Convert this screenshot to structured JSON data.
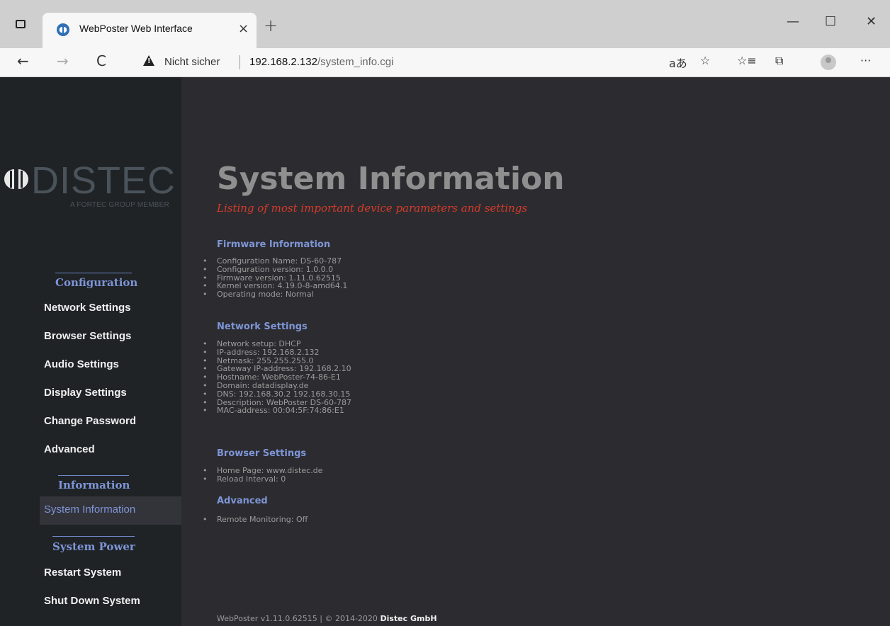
{
  "browser": {
    "tab_title": "WebPoster Web Interface",
    "tab_close": "×",
    "new_tab": "+",
    "minimize": "—",
    "maximize": "☐",
    "close": "✕",
    "back": "←",
    "forward": "→",
    "reload": "C",
    "security_label": "Nicht sicher",
    "url_host": "192.168.2.132",
    "url_path": "/system_info.cgi",
    "read_aloud": "aあ",
    "add_favorite": "☆",
    "favorites": "☆≡",
    "collections": "⧉",
    "more": "···"
  },
  "logo": {
    "text": "DISTEC",
    "subtitle": "A FORTEC GROUP MEMBER"
  },
  "sidebar": {
    "config_head": "Configuration",
    "config_items": [
      "Network Settings",
      "Browser Settings",
      "Audio Settings",
      "Display Settings",
      "Change Password",
      "Advanced"
    ],
    "info_head": "Information",
    "info_active": "System Information",
    "power_head": "System Power",
    "power_items": [
      "Restart System",
      "Shut Down System"
    ]
  },
  "main": {
    "title": "System Information",
    "subtitle": "Listing of most important device parameters and settings",
    "sections": [
      {
        "heading": "Firmware Information",
        "items": [
          "Configuration Name: DS-60-787",
          "Configuration version: 1.0.0.0",
          "Firmware version: 1.11.0.62515",
          "Kernel version: 4.19.0-8-amd64.1",
          "Operating mode: Normal"
        ]
      },
      {
        "heading": "Network Settings",
        "items": [
          "Network setup: DHCP",
          "IP-address: 192.168.2.132",
          "Netmask: 255.255.255.0",
          "Gateway IP-address: 192.168.2.10",
          "Hostname: WebPoster-74-86-E1",
          "Domain: datadisplay.de",
          "DNS: 192.168.30.2 192.168.30.15",
          "Description: WebPoster DS-60-787",
          "MAC-address: 00:04:5F:74:86:E1"
        ]
      },
      {
        "heading": "Browser Settings",
        "items": [
          "Home Page: www.distec.de",
          "Reload Interval: 0"
        ]
      },
      {
        "heading": "Advanced",
        "items": [
          "Remote Monitoring: Off"
        ]
      }
    ],
    "footer_prefix": "WebPoster v1.11.0.62515 | © 2014-2020",
    "footer_company": "Distec GmbH"
  }
}
